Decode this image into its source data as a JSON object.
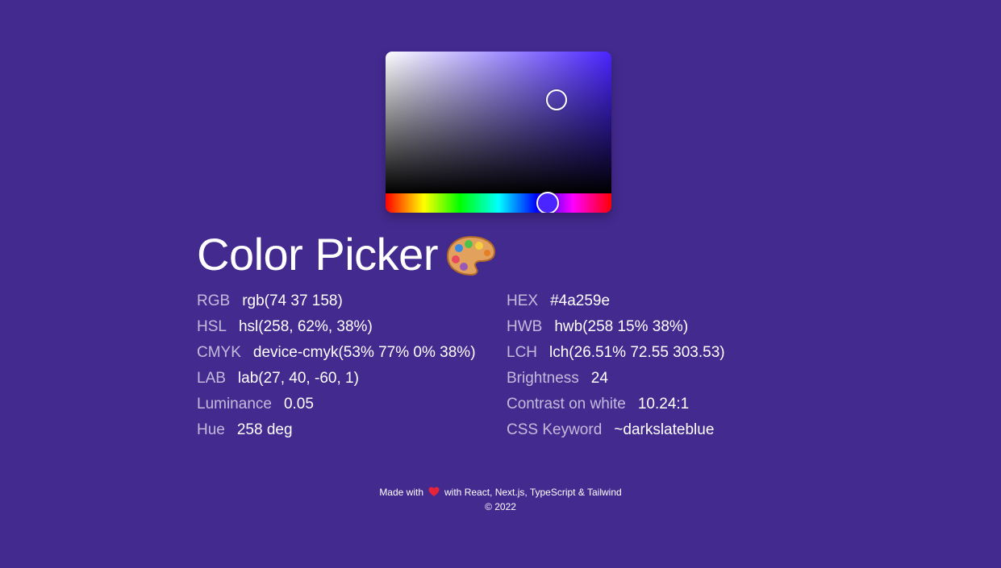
{
  "header": {
    "title": "Color Picker"
  },
  "picker": {
    "selected_hex": "#4a259e",
    "hue_color": "#4a25ff"
  },
  "values": {
    "left": [
      {
        "label": "RGB",
        "value": "rgb(74 37 158)"
      },
      {
        "label": "HSL",
        "value": "hsl(258, 62%, 38%)"
      },
      {
        "label": "CMYK",
        "value": "device-cmyk(53% 77% 0% 38%)"
      },
      {
        "label": "LAB",
        "value": "lab(27, 40, -60, 1)"
      },
      {
        "label": "Luminance",
        "value": "0.05"
      },
      {
        "label": "Hue",
        "value": "258 deg"
      }
    ],
    "right": [
      {
        "label": "HEX",
        "value": "#4a259e"
      },
      {
        "label": "HWB",
        "value": "hwb(258 15% 38%)"
      },
      {
        "label": "LCH",
        "value": "lch(26.51% 72.55 303.53)"
      },
      {
        "label": "Brightness",
        "value": "24"
      },
      {
        "label": "Contrast on white",
        "value": "10.24:1"
      },
      {
        "label": "CSS Keyword",
        "value": "~darkslateblue"
      }
    ]
  },
  "footer": {
    "made_with": "Made with",
    "tech": "with React, Next.js, TypeScript & Tailwind",
    "copyright": "© 2022"
  },
  "colors": {
    "background": "#432a8f",
    "heart": "#e3243b"
  },
  "icons": {
    "title_icon": "palette-icon",
    "footer_icon": "heart-icon"
  }
}
